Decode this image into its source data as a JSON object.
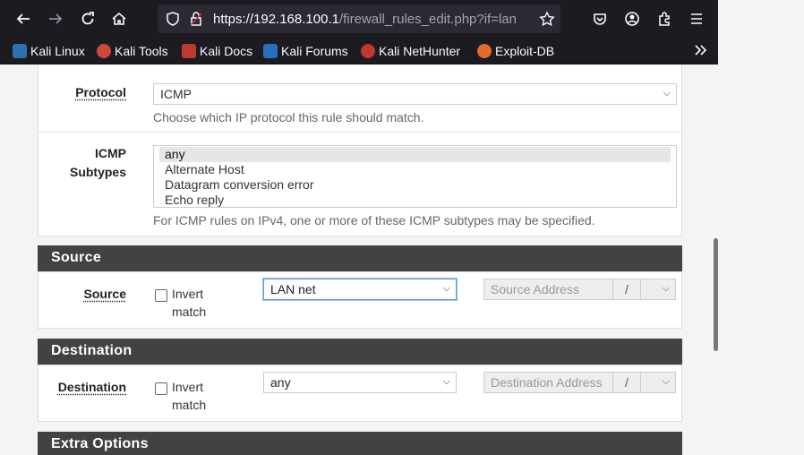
{
  "browser": {
    "url_main": "https://192.168.100.1",
    "url_path": "/firewall_rules_edit.php?if=lan",
    "bookmarks": [
      {
        "label": "Kali Linux",
        "color": "#2f6fb0"
      },
      {
        "label": "Kali Tools",
        "color": "#d0463b"
      },
      {
        "label": "Kali Docs",
        "color": "#c0392b"
      },
      {
        "label": "Kali Forums",
        "color": "#2a6fbf"
      },
      {
        "label": "Kali NetHunter",
        "color": "#c0392b"
      },
      {
        "label": "Exploit-DB",
        "color": "#e06b2a"
      }
    ]
  },
  "protocol": {
    "label": "Protocol",
    "value": "ICMP",
    "help": "Choose which IP protocol this rule should match."
  },
  "icmp": {
    "label_line1": "ICMP",
    "label_line2": "Subtypes",
    "options": [
      "any",
      "Alternate Host",
      "Datagram conversion error",
      "Echo reply"
    ],
    "help": "For ICMP rules on IPv4, one or more of these ICMP subtypes may be specified."
  },
  "source": {
    "section_title": "Source",
    "label": "Source",
    "invert_line1": "Invert",
    "invert_line2": "match",
    "type_value": "LAN net",
    "address_placeholder": "Source Address",
    "slash": "/"
  },
  "destination": {
    "section_title": "Destination",
    "label": "Destination",
    "invert_line1": "Invert",
    "invert_line2": "match",
    "type_value": "any",
    "address_placeholder": "Destination Address",
    "slash": "/"
  },
  "extra": {
    "section_title": "Extra Options"
  }
}
